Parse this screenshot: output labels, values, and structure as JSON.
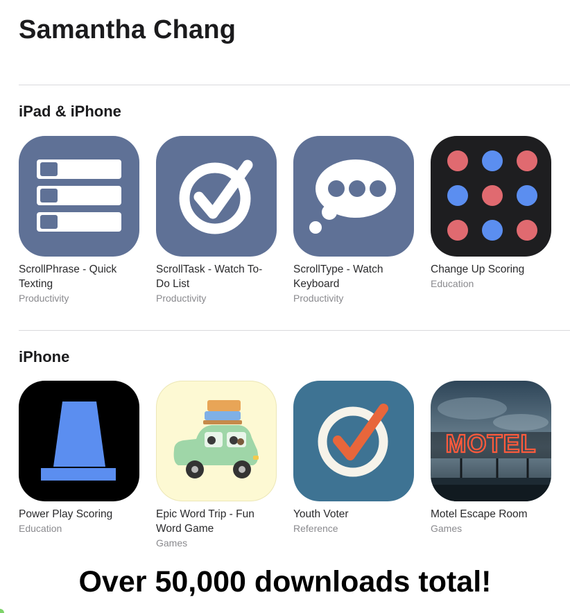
{
  "developer": {
    "name": "Samantha Chang"
  },
  "sections": [
    {
      "title": "iPad & iPhone",
      "apps": [
        {
          "name": "ScrollPhrase - Quick Texting",
          "category": "Productivity",
          "icon": "list-icon"
        },
        {
          "name": "ScrollTask - Watch To-Do List",
          "category": "Productivity",
          "icon": "checkmark-circle-icon"
        },
        {
          "name": "ScrollType - Watch Keyboard",
          "category": "Productivity",
          "icon": "thought-bubble-icon"
        },
        {
          "name": "Change Up Scoring",
          "category": "Education",
          "icon": "dots-grid-icon"
        }
      ]
    },
    {
      "title": "iPhone",
      "apps": [
        {
          "name": "Power Play Scoring",
          "category": "Education",
          "icon": "cone-icon"
        },
        {
          "name": "Epic Word Trip - Fun Word Game",
          "category": "Games",
          "icon": "car-icon"
        },
        {
          "name": "Youth Voter",
          "category": "Reference",
          "icon": "checkmark-circle-icon"
        },
        {
          "name": "Motel Escape Room",
          "category": "Games",
          "icon": "motel-sign-icon",
          "icon_text": "MOTEL"
        }
      ]
    }
  ],
  "footer": {
    "text": "Over 50,000 downloads total!"
  },
  "colors": {
    "slate_blue": "#5f7196",
    "dark_icon": "#1e1e20",
    "dot_red": "#e06a70",
    "dot_blue": "#5b8ef0",
    "cone_blue": "#5b8ef0",
    "voter_blue": "#3e7393",
    "check_orange": "#e8663b",
    "car_green": "#9fd6a8",
    "car_bg": "#fdf9d3"
  }
}
